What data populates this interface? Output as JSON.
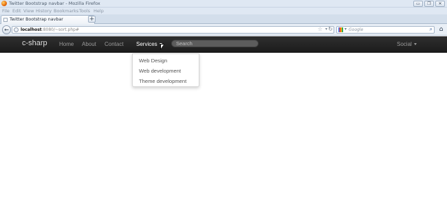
{
  "window": {
    "title": "Twitter Bootstrap navbar - Mozilla Firefox",
    "controls": {
      "minimize": "▭",
      "restore": "❐",
      "close": "✕"
    }
  },
  "menubar": [
    "File",
    "Edit",
    "View",
    "History",
    "Bookmarks",
    "Tools",
    "Help"
  ],
  "tab": {
    "title": "Twitter Bootstrap navbar",
    "new_tab_label": "+"
  },
  "toolbar": {
    "back_glyph": "←",
    "url_host": "localhost",
    "url_rest": ":8080/~sort.php#",
    "star_glyph": "☆",
    "dropdown_glyph": "▾",
    "reload_glyph": "↻",
    "search_placeholder": "Google",
    "search_dropdown_glyph": "▾",
    "search_go_glyph": "⌕",
    "home_glyph": "⌂"
  },
  "site_nav": {
    "brand": "c-sharp",
    "links": [
      "Home",
      "About",
      "Contact"
    ],
    "services_label": "Services",
    "search_placeholder": "Search",
    "social_label": "Social",
    "dropdown_items": [
      "Web Design",
      "Web development",
      "Theme development"
    ]
  },
  "icons": [
    "firefox-logo-icon",
    "minimize-icon",
    "restore-icon",
    "close-icon",
    "back-icon",
    "globe-icon",
    "star-icon",
    "reload-icon",
    "google-icon",
    "search-icon",
    "home-icon",
    "caret-icon",
    "mouse-cursor-icon"
  ]
}
